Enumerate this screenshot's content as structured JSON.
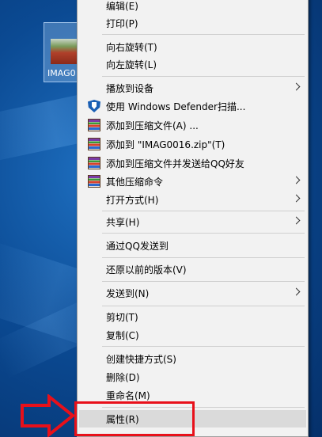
{
  "desktop": {
    "icon_label": "IMAG0"
  },
  "context_menu": {
    "items": [
      {
        "label": "编辑(E)"
      },
      {
        "label": "打印(P)"
      },
      {
        "label": "向右旋转(T)"
      },
      {
        "label": "向左旋转(L)"
      },
      {
        "label": "播放到设备"
      },
      {
        "label": "使用 Windows Defender扫描..."
      },
      {
        "label": "添加到压缩文件(A) ..."
      },
      {
        "label": "添加到 \"IMAG0016.zip\"(T)"
      },
      {
        "label": "添加到压缩文件并发送给QQ好友"
      },
      {
        "label": "其他压缩命令"
      },
      {
        "label": "打开方式(H)"
      },
      {
        "label": "共享(H)"
      },
      {
        "label": "通过QQ发送到"
      },
      {
        "label": "还原以前的版本(V)"
      },
      {
        "label": "发送到(N)"
      },
      {
        "label": "剪切(T)"
      },
      {
        "label": "复制(C)"
      },
      {
        "label": "创建快捷方式(S)"
      },
      {
        "label": "删除(D)"
      },
      {
        "label": "重命名(M)"
      },
      {
        "label": "属性(R)"
      }
    ]
  },
  "colors": {
    "highlight_box": "#e8101a",
    "menu_bg": "#f2f2f2",
    "hover_bg": "#dadada"
  }
}
